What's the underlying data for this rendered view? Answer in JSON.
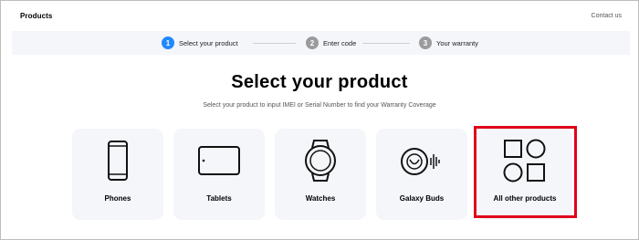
{
  "header": {
    "title": "Products",
    "contact_label": "Contact us"
  },
  "steps": [
    {
      "number": "1",
      "label": "Select your product"
    },
    {
      "number": "2",
      "label": "Enter code"
    },
    {
      "number": "3",
      "label": "Your warranty"
    }
  ],
  "main": {
    "heading": "Select your product",
    "subheading": "Select your product to input IMEI or Serial Number to find your Warranty Coverage"
  },
  "products": [
    {
      "label": "Phones",
      "icon": "phone-icon"
    },
    {
      "label": "Tablets",
      "icon": "tablet-icon"
    },
    {
      "label": "Watches",
      "icon": "watch-icon"
    },
    {
      "label": "Galaxy Buds",
      "icon": "earbuds-icon"
    },
    {
      "label": "All other products",
      "icon": "shapes-icon"
    }
  ],
  "colors": {
    "accent": "#2189ff",
    "highlight": "#e0001b",
    "panel": "#f4f6fa"
  }
}
